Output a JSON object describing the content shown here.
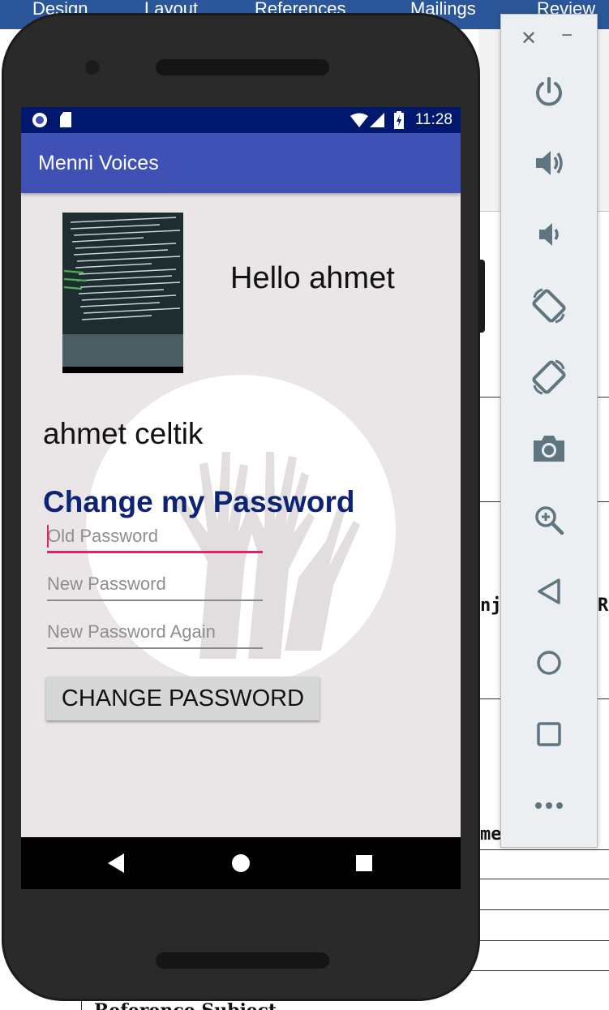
{
  "word": {
    "tabs": [
      "Design",
      "Layout",
      "References",
      "Mailings",
      "Review"
    ],
    "doc_fragments": [
      "nj",
      "Ry",
      "me",
      "Reference Subject"
    ]
  },
  "status_bar": {
    "time": "11:28"
  },
  "app": {
    "title": "Menni Voices",
    "greeting": "Hello ahmet",
    "full_name": "ahmet celtik",
    "section_title": "Change my Password",
    "fields": {
      "old_placeholder": "Old Password",
      "new_placeholder": "New Password",
      "new_again_placeholder": "New Password Again"
    },
    "change_button": "CHANGE PASSWORD"
  },
  "nav_icons": [
    "back-icon",
    "home-icon",
    "recents-icon"
  ],
  "emulator": {
    "buttons": [
      "power-icon",
      "volume-up-icon",
      "volume-down-icon",
      "rotate-left-icon",
      "rotate-right-icon",
      "camera-icon",
      "zoom-icon",
      "back-icon",
      "home-icon",
      "overview-icon",
      "more-icon"
    ]
  },
  "colors": {
    "app_bar": "#3f51b5",
    "status_bar": "#00176e",
    "accent": "#e91e63",
    "title_text": "#0d2375"
  }
}
